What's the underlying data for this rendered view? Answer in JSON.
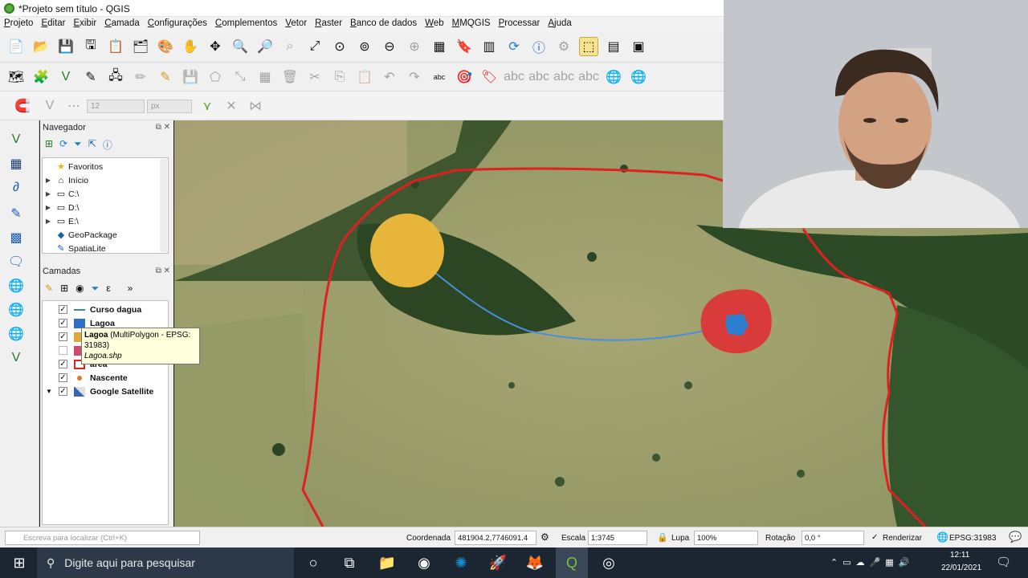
{
  "window": {
    "title": "*Projeto sem título - QGIS"
  },
  "menu": [
    "Projeto",
    "Editar",
    "Exibir",
    "Camada",
    "Configurações",
    "Complementos",
    "Vetor",
    "Raster",
    "Banco de dados",
    "Web",
    "MMQGIS",
    "Processar",
    "Ajuda"
  ],
  "snapping": {
    "tolerance": "12",
    "unit": "px"
  },
  "navigator": {
    "title": "Navegador",
    "items": [
      "Favoritos",
      "Início",
      "C:\\",
      "D:\\",
      "E:\\",
      "GeoPackage",
      "SpatiaLite"
    ]
  },
  "layers": {
    "title": "Camadas",
    "items": [
      {
        "name": "Curso dagua",
        "checked": true,
        "color": "#3f7fd1"
      },
      {
        "name": "Lagoa",
        "checked": true,
        "color": "#2e6fc9"
      },
      {
        "name": "",
        "checked": true,
        "color": "#e0a83a"
      },
      {
        "name": "",
        "checked": false,
        "color": "#d04a6a"
      },
      {
        "name": "área",
        "checked": true,
        "color": "#e02020"
      },
      {
        "name": "Nascente",
        "checked": true,
        "color": "#e07a30"
      },
      {
        "name": "Google Satellite",
        "checked": true,
        "color": "#3a66b0"
      }
    ]
  },
  "tooltip": {
    "line1_name": "Lagoa",
    "line1_rest": " (MultiPolygon - EPSG:",
    "line2": "31983)",
    "line3": "Lagoa.shp"
  },
  "status": {
    "locator_placeholder": "Escreva para localizar (Ctrl+K)",
    "coord_label": "Coordenada",
    "coord_value": "481904.2,7746091.4",
    "scale_label": "Escala",
    "scale_value": "1:3745",
    "magnifier_label": "Lupa",
    "magnifier_value": "100%",
    "rotation_label": "Rotação",
    "rotation_value": "0,0 °",
    "render_label": "Renderizar",
    "crs": "EPSG:31983"
  },
  "taskbar": {
    "search_placeholder": "Digite aqui para pesquisar",
    "time": "12:11",
    "date": "22/01/2021"
  },
  "colors": {
    "boundary": "#e02020",
    "circle_yellow": "#e7b53a",
    "circle_red": "#d93a3a",
    "lake_blue": "#2f7fd0",
    "stream": "#4a8fdc"
  }
}
